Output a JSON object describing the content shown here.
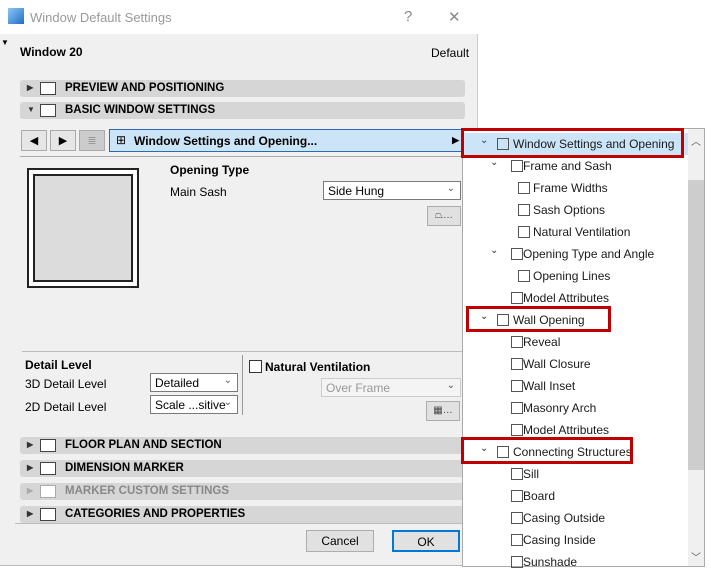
{
  "dialog": {
    "title": "Window Default Settings",
    "help": "?",
    "close": "✕",
    "name": "Window 20",
    "preset": "Default"
  },
  "sections": {
    "preview": "PREVIEW AND POSITIONING",
    "basic": "BASIC WINDOW SETTINGS",
    "floor": "FLOOR PLAN AND SECTION",
    "dimension": "DIMENSION MARKER",
    "marker": "MARKER CUSTOM SETTINGS",
    "categories": "CATEGORIES AND PROPERTIES"
  },
  "panel": {
    "selector": "Window Settings and Opening...",
    "prev": "◀",
    "next": "▶"
  },
  "opening": {
    "heading": "Opening Type",
    "main_sash_label": "Main Sash",
    "main_sash_value": "Side Hung",
    "btn": "…"
  },
  "detail": {
    "heading": "Detail Level",
    "d3_label": "3D Detail Level",
    "d3_value": "Detailed",
    "d2_label": "2D Detail Level",
    "d2_value": "Scale ...sitive"
  },
  "ventilation": {
    "label": "Natural Ventilation",
    "checked": false,
    "value": "Over Frame",
    "btn": "…"
  },
  "buttons": {
    "cancel": "Cancel",
    "ok": "OK"
  },
  "tree": [
    {
      "label": "Window Settings and Opening",
      "level": 0,
      "expanded": true,
      "icon": "window-grid-icon"
    },
    {
      "label": "Frame and Sash",
      "level": 1,
      "expanded": true,
      "icon": "frame-icon"
    },
    {
      "label": "Frame Widths",
      "level": 2,
      "icon": "frame-icon"
    },
    {
      "label": "Sash Options",
      "level": 2,
      "icon": "sash-icon"
    },
    {
      "label": "Natural Ventilation",
      "level": 2,
      "icon": "ventilation-icon"
    },
    {
      "label": "Opening Type and Angle",
      "level": 1,
      "expanded": true,
      "icon": "opening-angle-icon"
    },
    {
      "label": "Opening Lines",
      "level": 2,
      "icon": "opening-lines-icon"
    },
    {
      "label": "Model Attributes",
      "level": 1,
      "icon": "brush-icon"
    },
    {
      "label": "Wall Opening",
      "level": 0,
      "expanded": true,
      "icon": "wall-opening-icon"
    },
    {
      "label": "Reveal",
      "level": 1,
      "icon": "reveal-icon"
    },
    {
      "label": "Wall Closure",
      "level": 1,
      "icon": "wall-closure-icon"
    },
    {
      "label": "Wall Inset",
      "level": 1,
      "icon": "wall-inset-icon"
    },
    {
      "label": "Masonry Arch",
      "level": 1,
      "icon": "arch-icon"
    },
    {
      "label": "Model Attributes",
      "level": 1,
      "icon": "brush-icon"
    },
    {
      "label": "Connecting Structures",
      "level": 0,
      "expanded": true,
      "icon": "connecting-icon"
    },
    {
      "label": "Sill",
      "level": 1,
      "icon": "sill-icon"
    },
    {
      "label": "Board",
      "level": 1,
      "icon": "board-icon"
    },
    {
      "label": "Casing Outside",
      "level": 1,
      "icon": "casing-icon"
    },
    {
      "label": "Casing Inside",
      "level": 1,
      "icon": "casing-icon"
    },
    {
      "label": "Sunshade",
      "level": 1,
      "icon": "sunshade-icon"
    }
  ],
  "colors": {
    "highlight": "#c00000",
    "selected": "#cce4f7"
  }
}
